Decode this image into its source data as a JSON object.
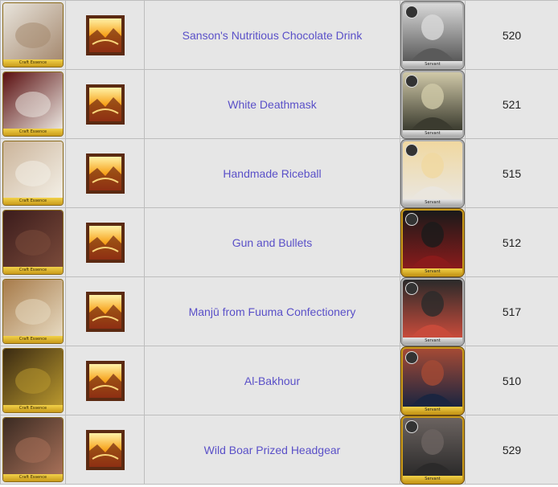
{
  "rows": [
    {
      "name": "Sanson's Nutritious Chocolate Drink",
      "number": "520",
      "ce_label": "Craft Essence",
      "servant_label": "Servant",
      "frame": "silver",
      "ce_colors": [
        "#e8e4dc",
        "#a68a70"
      ],
      "servant_colors": [
        "#5a5a5a",
        "#d9d9d9"
      ]
    },
    {
      "name": "White Deathmask",
      "number": "521",
      "ce_label": "Craft Essence",
      "servant_label": "Servant",
      "frame": "silver",
      "ce_colors": [
        "#5a0f10",
        "#e9e4de"
      ],
      "servant_colors": [
        "#3b3b2f",
        "#d0c9a8"
      ]
    },
    {
      "name": "Handmade Riceball",
      "number": "515",
      "ce_label": "Craft Essence",
      "servant_label": "Servant",
      "frame": "silver",
      "ce_colors": [
        "#cbb49a",
        "#f3efe6"
      ],
      "servant_colors": [
        "#eae6de",
        "#f0d8a0"
      ]
    },
    {
      "name": "Gun and Bullets",
      "number": "512",
      "ce_label": "Craft Essence",
      "servant_label": "Servant",
      "frame": "gold",
      "ce_colors": [
        "#3b1c1c",
        "#7a4a3a"
      ],
      "servant_colors": [
        "#8a1b1b",
        "#1a1a1a"
      ]
    },
    {
      "name": "Manjū from Fuuma Confectionery",
      "number": "517",
      "ce_label": "Craft Essence",
      "servant_label": "Servant",
      "frame": "silver",
      "ce_colors": [
        "#a77b4a",
        "#e6d9c0"
      ],
      "servant_colors": [
        "#c84b3b",
        "#2a2a2a"
      ]
    },
    {
      "name": "Al-Bakhour",
      "number": "510",
      "ce_label": "Craft Essence",
      "servant_label": "Servant",
      "frame": "gold",
      "ce_colors": [
        "#3a2a12",
        "#b8972e"
      ],
      "servant_colors": [
        "#1b2540",
        "#a44a35"
      ]
    },
    {
      "name": "Wild Boar Prized Headgear",
      "number": "529",
      "ce_label": "Craft Essence",
      "servant_label": "Servant",
      "frame": "gold",
      "ce_colors": [
        "#3a2a22",
        "#a77058"
      ],
      "servant_colors": [
        "#2b2a2a",
        "#6b6360"
      ]
    }
  ]
}
